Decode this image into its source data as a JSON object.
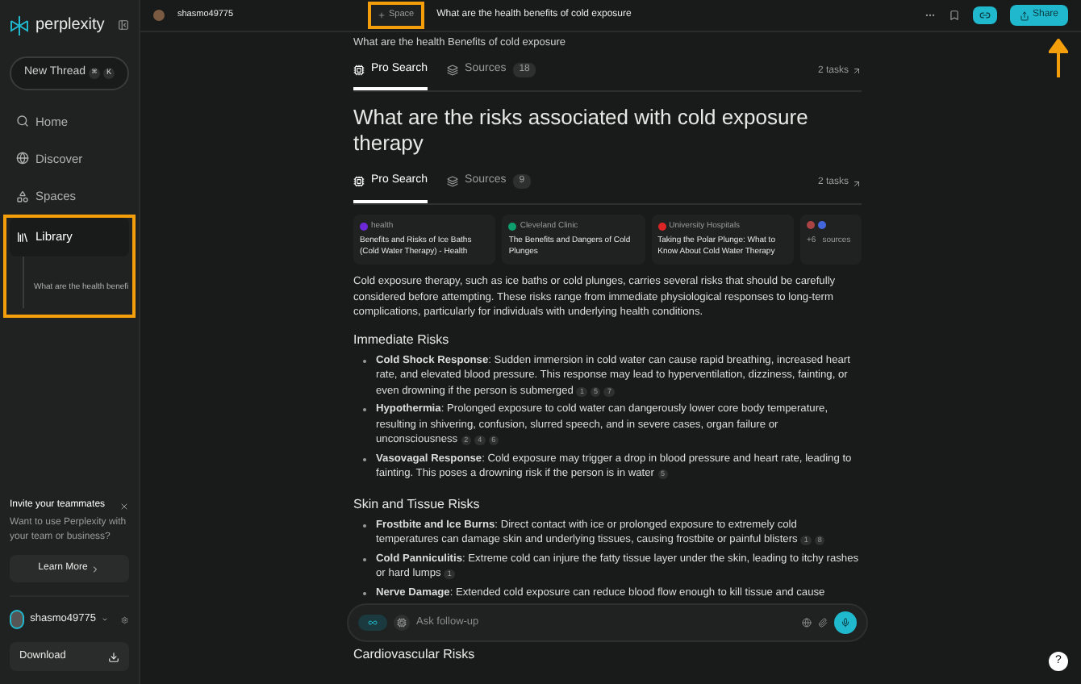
{
  "sidebar": {
    "logo": "perplexity",
    "new_thread": {
      "label": "New Thread",
      "shortcut": [
        "⌘",
        "K"
      ]
    },
    "nav": [
      {
        "label": "Home",
        "selected": false,
        "annotated": false
      },
      {
        "label": "Discover",
        "selected": false,
        "annotated": false
      },
      {
        "label": "Spaces",
        "selected": false,
        "annotated": false
      },
      {
        "label": "Library",
        "selected": true,
        "annotated": true
      }
    ],
    "library_items": [
      "What are the health benefi"
    ],
    "invite": {
      "title": "Invite your teammates",
      "text": "Want to use Perplexity with your team or business?",
      "button": "Learn More"
    },
    "user": {
      "name": "shasmo49775"
    },
    "download": "Download"
  },
  "topbar": {
    "user": "shasmo49775",
    "space_button": {
      "label": "Space",
      "annotated": true
    },
    "title": "What are the health benefits of cold exposure",
    "share": {
      "label": "Share",
      "annotated": true
    }
  },
  "previous_thread": {
    "title": "What are the health Benefits of cold exposure",
    "tabs": [
      {
        "label": "Pro Search",
        "selected": true
      },
      {
        "label": "Sources",
        "count": "18",
        "selected": false
      }
    ],
    "tasks": "2 tasks"
  },
  "thread": {
    "title": "What are the risks associated with cold exposure therapy",
    "tabs": [
      {
        "label": "Pro Search",
        "selected": true
      },
      {
        "label": "Sources",
        "count": "9",
        "selected": false
      }
    ],
    "tasks": "2 tasks",
    "sources": [
      {
        "site": "health",
        "title": "Benefits and Risks of Ice Baths (Cold Water Therapy) - Health",
        "color": "#6d28d9"
      },
      {
        "site": "Cleveland Clinic",
        "title": "The Benefits and Dangers of Cold Plunges",
        "color": "#0e9f6e"
      },
      {
        "site": "University Hospitals",
        "title": "Taking the Polar Plunge: What to Know About Cold Water Therapy",
        "color": "#dc2626"
      }
    ],
    "more_sources": {
      "count": "+6",
      "label": "sources"
    },
    "intro": "Cold exposure therapy, such as ice baths or cold plunges, carries several risks that should be carefully considered before attempting. These risks range from immediate physiological responses to long-term complications, particularly for individuals with underlying health conditions.",
    "sections": [
      {
        "heading": "Immediate Risks",
        "items": [
          {
            "text": "**Cold Shock Response**: Sudden immersion in cold water can cause rapid breathing, increased heart rate, and elevated blood pressure. This response may lead to hyperventilation, dizziness, fainting, or even drowning if the person is submerged",
            "citations": [
              "1",
              "5",
              "7"
            ]
          },
          {
            "text": "**Hypothermia**: Prolonged exposure to cold water can dangerously lower core body temperature, resulting in shivering, confusion, slurred speech, and in severe cases, organ failure or unconsciousness",
            "citations": [
              "2",
              "4",
              "6"
            ]
          },
          {
            "text": "**Vasovagal Response**: Cold exposure may trigger a drop in blood pressure and heart rate, leading to fainting. This poses a drowning risk if the person is in water",
            "citations": [
              "5"
            ]
          }
        ]
      },
      {
        "heading": "Skin and Tissue Risks",
        "items": [
          {
            "text": "**Frostbite and Ice Burns**: Direct contact with ice or prolonged exposure to extremely cold temperatures can damage skin and underlying tissues, causing frostbite or painful blisters",
            "citations": [
              "1",
              "8"
            ]
          },
          {
            "text": "**Cold Panniculitis**: Extreme cold can injure the fatty tissue layer under the skin, leading to itchy rashes or hard lumps",
            "citations": [
              "1"
            ]
          },
          {
            "text": "**Nerve Damage**: Extended cold exposure can reduce blood flow enough to kill tissue and cause"
          }
        ]
      }
    ],
    "next_heading": "Cardiovascular Risks"
  },
  "followup": {
    "placeholder": "Ask follow-up"
  },
  "help": "?"
}
